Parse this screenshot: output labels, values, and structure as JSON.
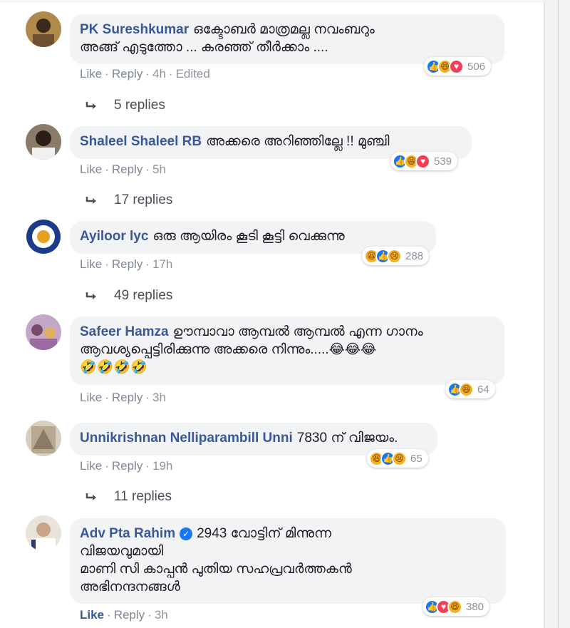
{
  "comments": [
    {
      "author": "PK Sureshkumar",
      "text_lines": [
        "ഒക്ടോബർ മാത്രമല്ല നവംബറും",
        "അങ്ങ് എടുത്തോ ... കരഞ്ഞ് തീർക്കാം ...."
      ],
      "actions": {
        "like": "Like",
        "reply": "Reply",
        "time": "4h",
        "edited": "Edited"
      },
      "reaction_icons": [
        "like-icon",
        "haha-icon",
        "love-icon"
      ],
      "reaction_count": "506",
      "replies": "5 replies"
    },
    {
      "author": "Shaleel Shaleel RB",
      "text_lines": [
        "അക്കരെ അറിഞ്ഞില്ലേ !! മുഞ്ചി"
      ],
      "actions": {
        "like": "Like",
        "reply": "Reply",
        "time": "5h"
      },
      "reaction_icons": [
        "like-icon",
        "haha-icon",
        "love-icon"
      ],
      "reaction_count": "539",
      "replies": "17 replies"
    },
    {
      "author": "Ayiloor lyc",
      "text_lines": [
        "ഒരു ആയിരം കൂടി കൂട്ടി വെക്കുന്നു"
      ],
      "actions": {
        "like": "Like",
        "reply": "Reply",
        "time": "17h"
      },
      "reaction_icons": [
        "haha-icon",
        "like-icon",
        "sad-icon"
      ],
      "reaction_count": "288",
      "replies": "49 replies"
    },
    {
      "author": "Safeer Hamza",
      "text_lines": [
        "ഊമ്പാവാ ആമ്പൽ ആമ്പൽ എന്ന ഗാനം",
        "ആവശ്യപ്പെട്ടിരിക്കുന്നു അക്കരെ നിന്നും.....😂😂😂",
        "🤣🤣🤣🤣"
      ],
      "actions": {
        "like": "Like",
        "reply": "Reply",
        "time": "3h"
      },
      "reaction_icons": [
        "like-icon",
        "haha-icon"
      ],
      "reaction_count": "64"
    },
    {
      "author": "Unnikrishnan Nelliparambill Unni",
      "text_lines": [
        "7830 ന് വിജയം."
      ],
      "actions": {
        "like": "Like",
        "reply": "Reply",
        "time": "19h"
      },
      "reaction_icons": [
        "haha-icon",
        "like-icon",
        "sad-icon"
      ],
      "reaction_count": "65",
      "replies": "11 replies"
    },
    {
      "author": "Adv Pta Rahim",
      "text_lines": [
        "2943 വോട്ടിന് മിന്നുന്ന",
        "വിജയവുമായി",
        "മാണി സി കാപ്പൻ പുതിയ സഹപ്രവർത്തകൻ",
        "അഭിനന്ദനങ്ങൾ"
      ],
      "actions": {
        "like": "Like",
        "reply": "Reply",
        "time": "3h"
      },
      "reaction_icons": [
        "like-icon",
        "love-icon",
        "haha-icon"
      ],
      "reaction_count": "380"
    }
  ],
  "colors": {
    "author": "#385898",
    "bubble": "#f2f3f5",
    "meta": "#8d949e",
    "like_blue": "#1877f2",
    "love_red": "#f33e58",
    "haha_yellow": "#f7b125"
  }
}
